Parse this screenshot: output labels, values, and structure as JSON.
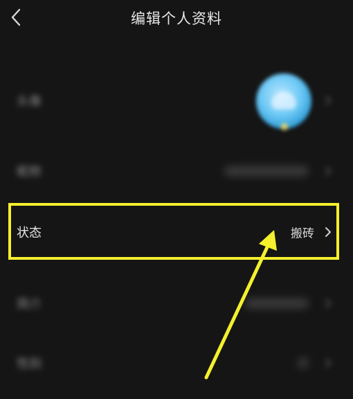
{
  "header": {
    "title": "编辑个人资料"
  },
  "rows": {
    "avatar": {
      "label": "头像"
    },
    "nickname": {
      "label": "昵称"
    },
    "status": {
      "label": "状态",
      "value": "搬砖"
    },
    "row4": {
      "label": "简介"
    },
    "row5": {
      "label": "性别"
    }
  },
  "colors": {
    "background": "#151515",
    "highlight": "#f4f02d",
    "text": "#e6e6e6"
  },
  "icons": [
    "back-icon",
    "chevron-right-icon"
  ]
}
